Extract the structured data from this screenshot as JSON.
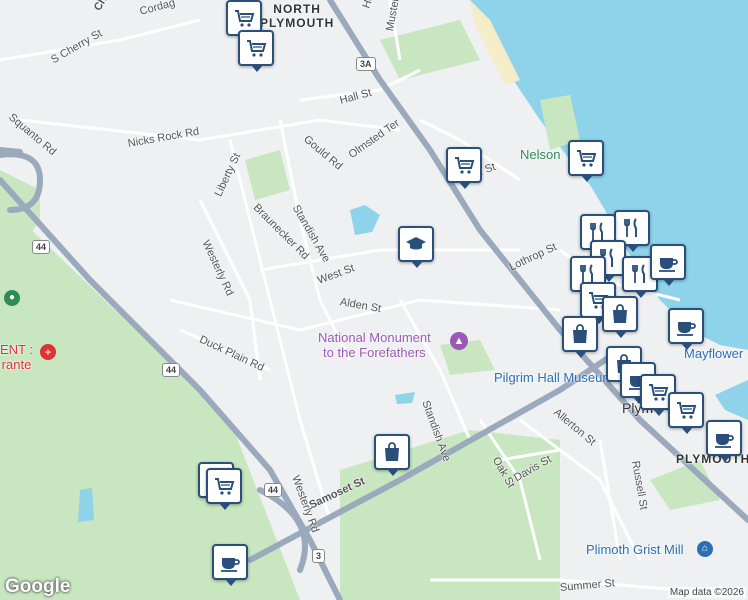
{
  "map": {
    "streets": [
      {
        "name": "S Cherry St"
      },
      {
        "name": "Cordag"
      },
      {
        "name": "Che"
      },
      {
        "name": "Squanto Rd"
      },
      {
        "name": "Nicks Rock Rd"
      },
      {
        "name": "Liberty St"
      },
      {
        "name": "Hall St"
      },
      {
        "name": "Gould Rd"
      },
      {
        "name": "Olmsted Ter"
      },
      {
        "name": "Braunecker Rd"
      },
      {
        "name": "Standish Ave"
      },
      {
        "name": "Westerly Rd"
      },
      {
        "name": "West St"
      },
      {
        "name": "Alden St"
      },
      {
        "name": "Duck Plain Rd"
      },
      {
        "name": "Lothrop St"
      },
      {
        "name": "N St"
      },
      {
        "name": "Standish Ave"
      },
      {
        "name": "Allerton St"
      },
      {
        "name": "Oak St"
      },
      {
        "name": "Davis St"
      },
      {
        "name": "Russell St"
      },
      {
        "name": "Samoset St"
      },
      {
        "name": "Westerly Rd"
      },
      {
        "name": "Summer St"
      },
      {
        "name": "Muster Fi"
      },
      {
        "name": "Ho"
      }
    ],
    "towns": [
      {
        "name": "NORTH\nPLYMOUTH"
      },
      {
        "name": "PLYMOUTH"
      },
      {
        "name": "Plym"
      }
    ],
    "places": [
      {
        "name": "National Monument\nto the Forefathers",
        "color": "#9b59b6"
      },
      {
        "name": "Pilgrim Hall Museum",
        "color": "#2a6fb5"
      },
      {
        "name": "Mayflower",
        "color": "#2a6fb5"
      },
      {
        "name": "Plimoth Grist Mill",
        "color": "#2a6fb5"
      },
      {
        "name": "Nelson",
        "color": "#2e8b57"
      },
      {
        "name": "ENT :\nrante",
        "color": "#d33"
      }
    ],
    "shields": [
      {
        "label": "3A"
      },
      {
        "label": "44"
      },
      {
        "label": "44"
      },
      {
        "label": "44"
      },
      {
        "label": "3"
      }
    ],
    "markers": [
      {
        "icon": "cart-icon"
      },
      {
        "icon": "cart-icon"
      },
      {
        "icon": "cart-icon"
      },
      {
        "icon": "cart-icon"
      },
      {
        "icon": "school-icon"
      },
      {
        "icon": "restaurant-icon"
      },
      {
        "icon": "restaurant-icon"
      },
      {
        "icon": "restaurant-icon"
      },
      {
        "icon": "restaurant-icon"
      },
      {
        "icon": "restaurant-icon"
      },
      {
        "icon": "coffee-icon"
      },
      {
        "icon": "cart-icon"
      },
      {
        "icon": "shopping-bag-icon"
      },
      {
        "icon": "shopping-bag-icon"
      },
      {
        "icon": "shopping-bag-icon"
      },
      {
        "icon": "coffee-icon"
      },
      {
        "icon": "coffee-icon"
      },
      {
        "icon": "cart-icon"
      },
      {
        "icon": "coffee-icon"
      },
      {
        "icon": "cart-icon"
      },
      {
        "icon": "cart-icon"
      },
      {
        "icon": "shopping-bag-icon"
      },
      {
        "icon": "coffee-icon"
      },
      {
        "icon": "coffee-icon"
      }
    ],
    "logo": "Google",
    "attribution": "Map data ©2026"
  },
  "colors": {
    "water": "#8fd3ea",
    "park": "#c8e6c0",
    "highway": "#9aa9bc",
    "marker_border": "#2a4f7a"
  }
}
